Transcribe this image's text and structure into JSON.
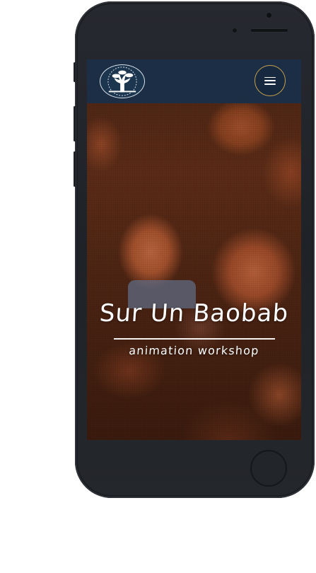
{
  "header": {
    "logo_name": "baobab-logo-icon",
    "menu_icon": "hamburger-icon"
  },
  "hero": {
    "title": "Sur Un Baobab",
    "subtitle": "animation workshop"
  },
  "colors": {
    "header_background": "#18304a",
    "menu_button_border": "#c8a24a",
    "hero_text": "#ffffff",
    "device_body": "#22252a"
  }
}
